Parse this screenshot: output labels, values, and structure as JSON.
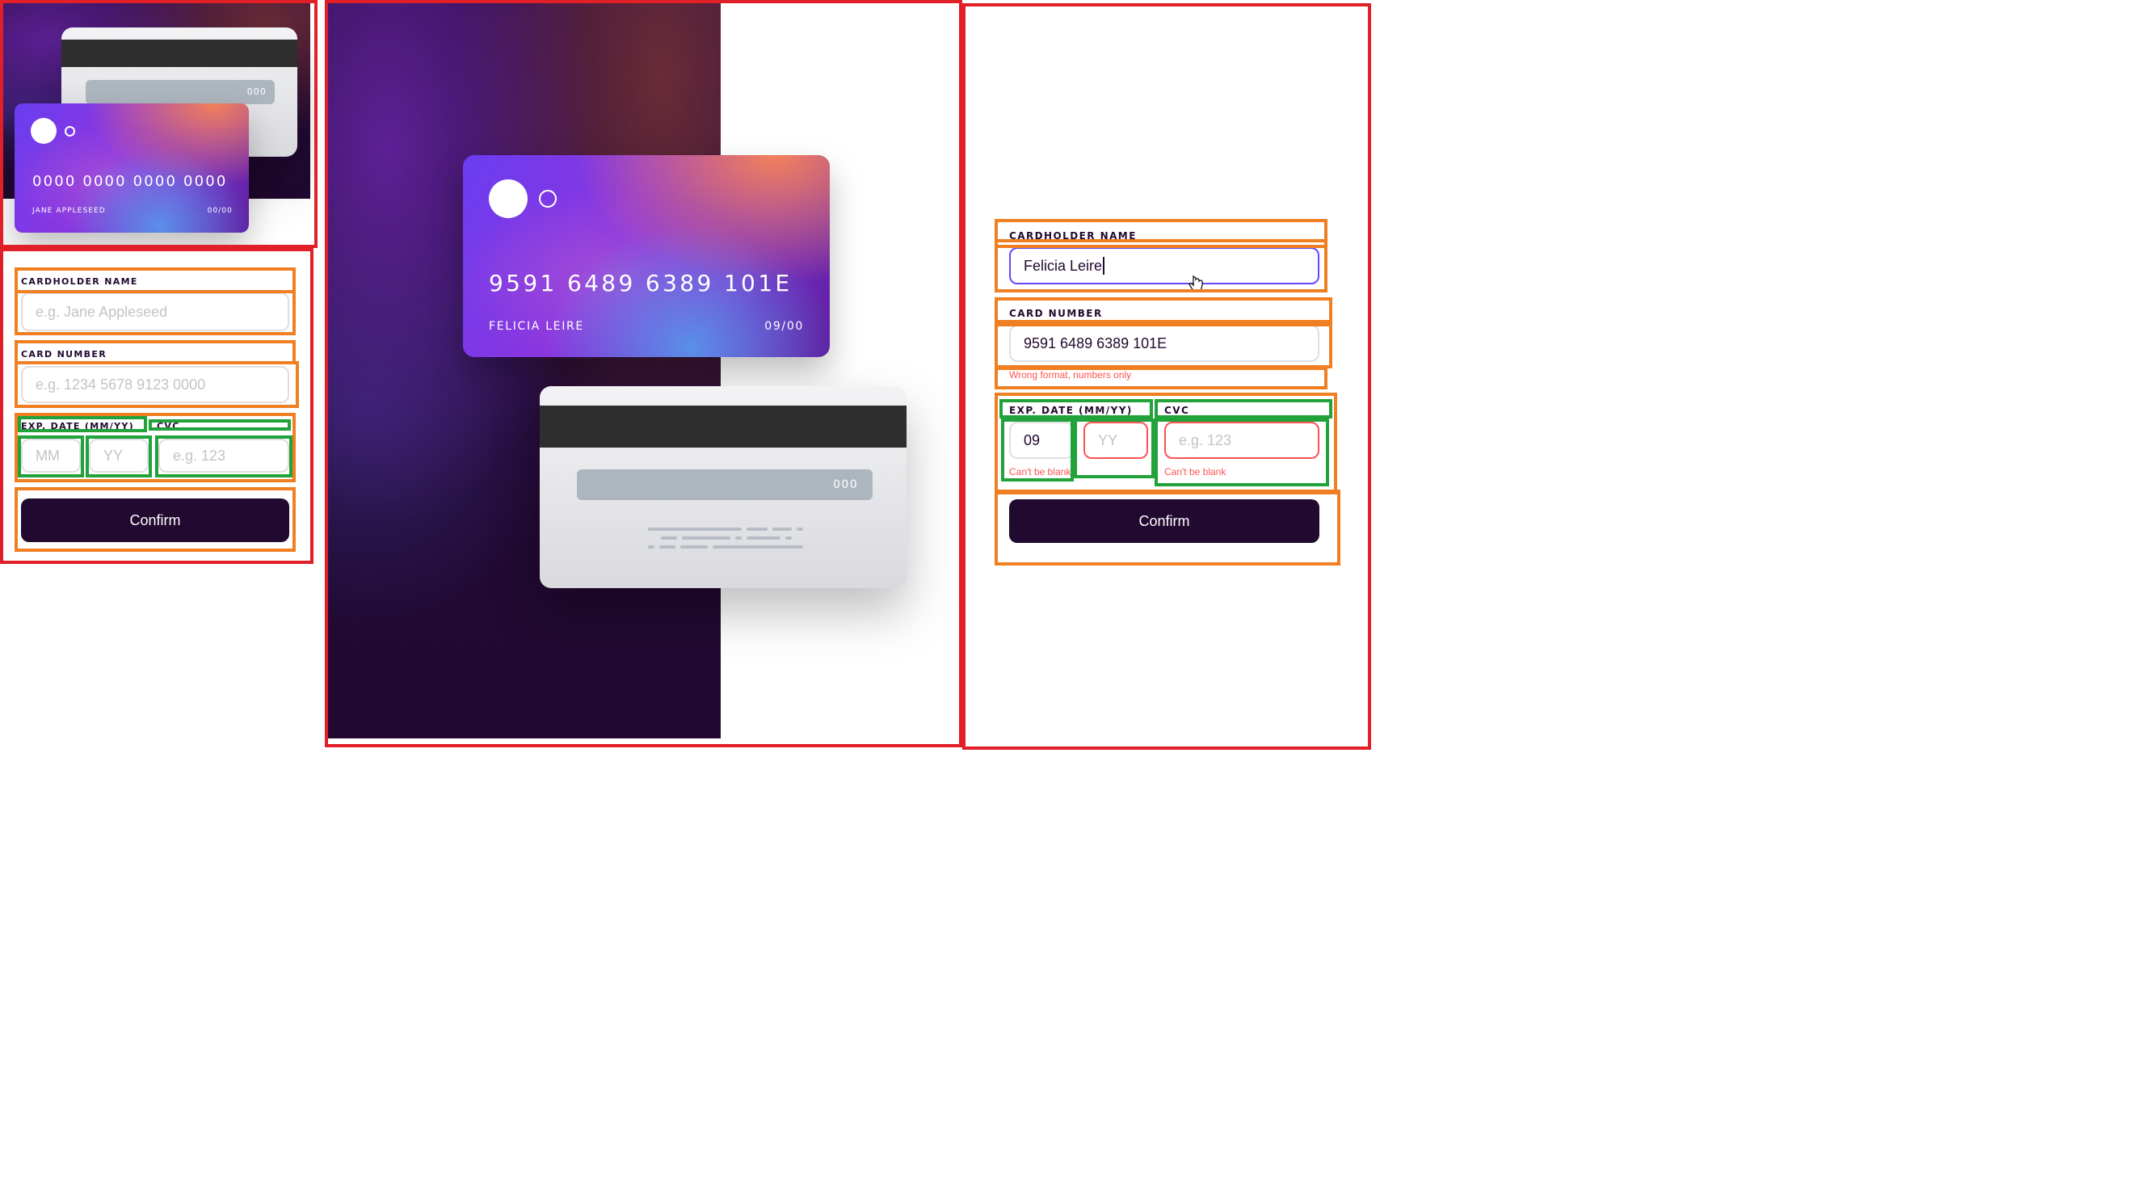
{
  "mobile_preview": {
    "card_front": {
      "number": "0000 0000 0000 0000",
      "name": "JANE APPLESEED",
      "exp": "00/00"
    },
    "card_back": {
      "cvc": "000"
    },
    "form": {
      "name_label": "CARDHOLDER NAME",
      "name_placeholder": "e.g. Jane Appleseed",
      "number_label": "CARD NUMBER",
      "number_placeholder": "e.g. 1234 5678 9123 0000",
      "exp_label": "EXP. DATE (MM/YY)",
      "cvc_label": "CVC",
      "mm_placeholder": "MM",
      "yy_placeholder": "YY",
      "cvc_placeholder": "e.g. 123",
      "confirm": "Confirm"
    }
  },
  "desktop_cards": {
    "card_front": {
      "number": "9591 6489 6389 101E",
      "name": "FELICIA LEIRE",
      "exp": "09/00"
    },
    "card_back": {
      "cvc": "000"
    }
  },
  "desktop_form": {
    "name_label": "CARDHOLDER NAME",
    "name_value": "Felicia Leire",
    "number_label": "CARD NUMBER",
    "number_value": "9591 6489 6389 101E",
    "number_error": "Wrong format, numbers only",
    "exp_label": "EXP. DATE (MM/YY)",
    "cvc_label": "CVC",
    "mm_value": "09",
    "yy_placeholder": "YY",
    "cvc_placeholder": "e.g. 123",
    "exp_error": "Can't be blank",
    "cvc_error": "Can't be blank",
    "confirm": "Confirm"
  },
  "colors": {
    "dark_violet": "#21092f",
    "error_red": "#ff5252",
    "annotation_red": "#e01f26",
    "annotation_orange": "#f07f22",
    "annotation_green": "#22a23a",
    "annotation_yellow": "#f2ef1e"
  }
}
